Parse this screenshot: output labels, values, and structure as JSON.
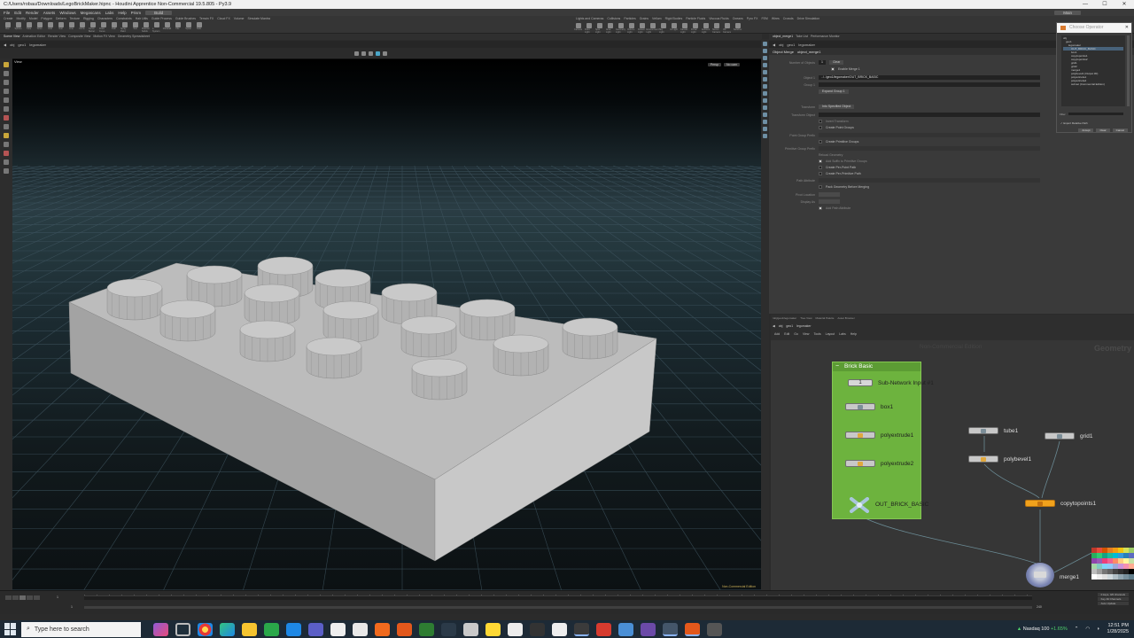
{
  "titlebar": {
    "title": "C:/Users/robau/Downloads/LegoBrickMaker.hipnc - Houdini Apprentice Non-Commercial 19.5.805 - Py3.9",
    "minimize": "—",
    "maximize": "☐",
    "close": "✕"
  },
  "menubar": {
    "items": [
      "File",
      "Edit",
      "Render",
      "Assets",
      "Windows",
      "Megascans",
      "Labs",
      "Help",
      "Prism"
    ],
    "desktop": "Build",
    "right": "Main"
  },
  "shelf": {
    "tabs": [
      "Create",
      "Modify",
      "Model",
      "Polygon",
      "Deform",
      "Texture",
      "Rigging",
      "Characters",
      "Constraints",
      "Hair Utils",
      "Guide Process",
      "Guide Brushes",
      "Terrain FX",
      "Cloud FX",
      "Volume",
      "Simulate Mantra"
    ],
    "tools": [
      "Box",
      "Sphere",
      "Tube",
      "Torus",
      "Grid",
      "Null",
      "Line",
      "Circle",
      "Curve Bezier",
      "Draw Curve",
      "Path",
      "Spray Paint",
      "Text",
      "Platonic Solids",
      "L-System",
      "Metaball",
      "File",
      "Spiral",
      "Helix"
    ],
    "right_tabs": [
      "Lights and Cameras",
      "Collisions",
      "Particles",
      "Grains",
      "Vellum",
      "Rigid Bodies",
      "Particle Fluids",
      "Viscous Fluids",
      "Oceans",
      "Pyro FX",
      "FEM",
      "Wires",
      "Crowds",
      "Drive Simulation"
    ],
    "right_tools": [
      "Camera",
      "Point Light",
      "Spot Light",
      "Area Light",
      "Geometry Light",
      "Volume Light",
      "Distant Light",
      "Environment Light",
      "Sky Light",
      "GI Light",
      "Caustic Light",
      "Portal Light",
      "Ambient Light",
      "Stereo Camera",
      "VR Camera",
      "Switcher"
    ]
  },
  "scene_tabs": {
    "tabs": [
      "Scene View",
      "Animation Editor",
      "Render View",
      "Composite View",
      "Motion FX View",
      "Geometry Spreadsheet"
    ],
    "path": [
      "obj",
      "geo1",
      "legomaker"
    ]
  },
  "viewport": {
    "label": "View",
    "persp": "Persp",
    "cam": "No cam",
    "watermark": "Non-Commercial Edition"
  },
  "param_tabs": {
    "tabs": [
      "object_merge1",
      "Take List",
      "Performance Monitor"
    ],
    "path": [
      "obj",
      "geo1",
      "legomaker"
    ]
  },
  "params": {
    "node_type": "Object Merge",
    "node_name": "object_merge1",
    "num_objects_label": "Number of Objects",
    "num_objects": "1",
    "clear": "Clear",
    "enable_label": "Enable Merge 1",
    "object_label": "Object 1",
    "object_value": "../../geo1/legomaker/OUT_BRICK_BASIC",
    "group_label": "Group 1",
    "expand_group": "Expand Group 1",
    "transform_label": "Transform",
    "transform_value": "Into Specified Object",
    "transform_object_label": "Transform Object",
    "invert_transform": "Invert Transform",
    "create_point_groups": "Create Point Groups",
    "point_group_prefix": "Point Group Prefix",
    "create_primitive_groups": "Create Primitive Groups",
    "primitive_group_prefix": "Primitive Group Prefix",
    "reload_geo": "Reload Geometry",
    "add_suffix": "Add Suffix to Primitive Groups",
    "create_per_point_path": "Create Per-Point Path",
    "create_per_prim_path": "Create Per-Primitive Path",
    "path_attribute": "Path Attribute",
    "pack_before_merging": "Pack Geometry Before Merging",
    "pivot_location": "Pivot Location",
    "display_as": "Display As",
    "add_path_attr": "Add Path Attribute"
  },
  "chooser": {
    "title": "Choose Operator",
    "close": "✕",
    "tree": [
      "obj",
      "geo1",
      "legomaker",
      "OUT_BRICK_BASIC",
      "box1",
      "copytopoints1",
      "copytopoints2",
      "grid1",
      "grid2",
      "merge1",
      "polybevel1 (Output #0)",
      "polyextrude1",
      "polyextrude2",
      "subnet (Commercial Edition)"
    ],
    "filter": "Filter",
    "relative": "Export Relative Path",
    "accept": "Accept",
    "clear": "Clear",
    "cancel": "Cancel"
  },
  "network_tabs": {
    "tabs": [
      "/obj/geo1/legomaker",
      "Tree View",
      "Material Palette",
      "Asset Browser"
    ],
    "path": [
      "obj",
      "geo1",
      "legomaker"
    ],
    "menu": [
      "Add",
      "Edit",
      "Go",
      "View",
      "Tools",
      "Layout",
      "Labs",
      "Help"
    ]
  },
  "network": {
    "watermark": "Non-Commercial Edition",
    "context": "Geometry",
    "subnet_title": "Brick Basic",
    "nodes": {
      "subnet_input": "Sub-Network Input #1",
      "subnet_input_num": "1",
      "box1": "box1",
      "polyextrude1": "polyextrude1",
      "polyextrude2": "polyextrude2",
      "out": "OUT_BRICK_BASIC",
      "tube1": "tube1",
      "polybevel1": "polybevel1",
      "grid1": "grid1",
      "copytopoints1": "copytopoints1",
      "merge1": "merge1"
    },
    "palette": [
      "#c0392b",
      "#e74c3c",
      "#d35400",
      "#e67e22",
      "#f39c12",
      "#f1c40f",
      "#d4e157",
      "#9ccc65",
      "#27ae60",
      "#2ecc71",
      "#16a085",
      "#1abc9c",
      "#00bcd4",
      "#3498db",
      "#2980b9",
      "#5c6bc0",
      "#8e44ad",
      "#9b59b6",
      "#ec407a",
      "#f06292",
      "#ff8a65",
      "#ffcc80",
      "#fff59d",
      "#c5e1a5",
      "#a5d6a7",
      "#80cbc4",
      "#81d4fa",
      "#90caf9",
      "#9fa8da",
      "#ce93d8",
      "#f48fb1",
      "#ffab91",
      "#bdbdbd",
      "#9e9e9e",
      "#757575",
      "#616161",
      "#424242",
      "#303030",
      "#212121",
      "#000000",
      "#ffffff",
      "#eeeeee",
      "#e0e0e0",
      "#cfd8dc",
      "#b0bec5",
      "#90a4ae",
      "#78909c",
      "#607d8b"
    ]
  },
  "timeline": {
    "start": "1",
    "end": "240",
    "current": "1",
    "keys": "0 keys, 0/0 channels",
    "key_all": "Key All Channels",
    "auto_update": "Auto Update"
  },
  "taskbar": {
    "search_placeholder": "Type here to search",
    "stock_name": "Nasdaq 100",
    "stock_change": "+1.65%",
    "time": "12:51 PM",
    "date": "1/28/2025"
  }
}
